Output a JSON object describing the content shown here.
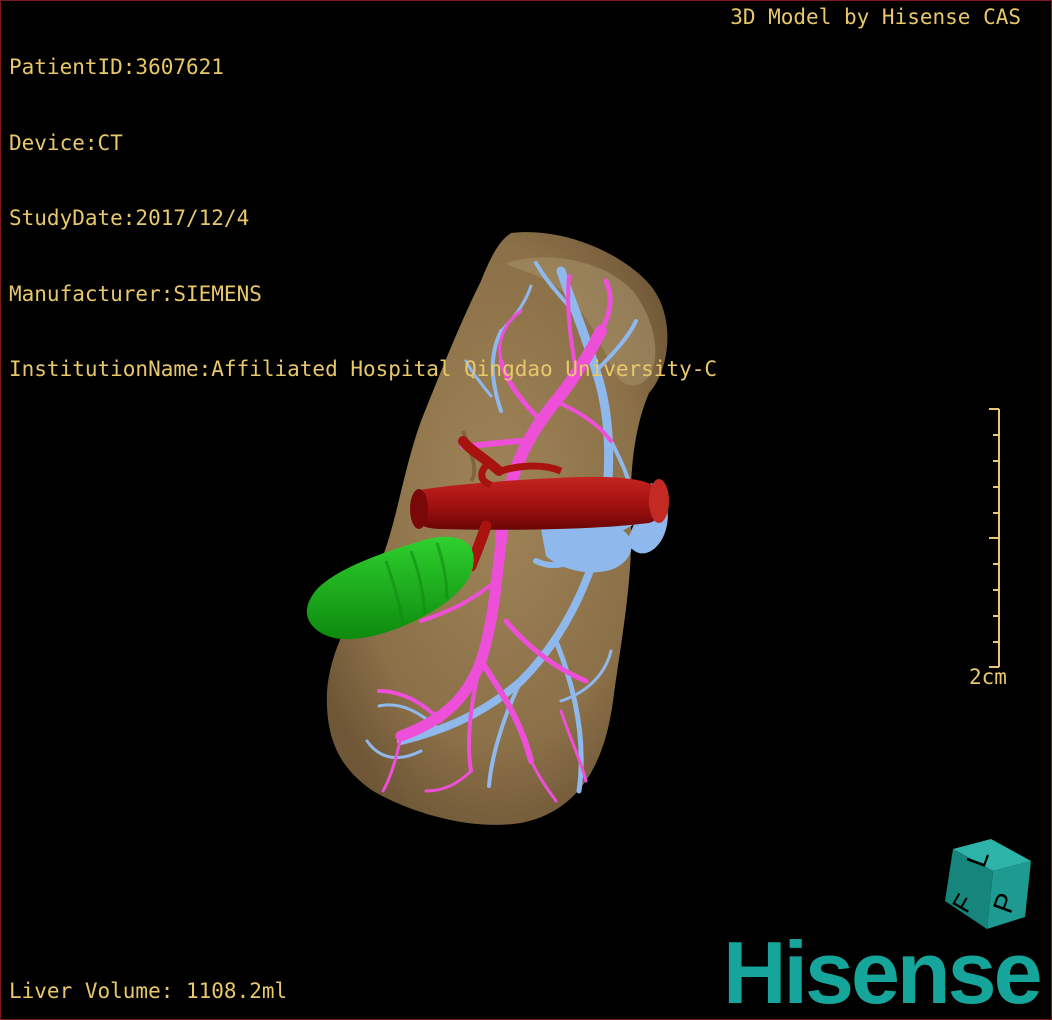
{
  "study": {
    "patient_id": "PatientID:3607621",
    "device": "Device:CT",
    "study_date": "StudyDate:2017/12/4",
    "manufacturer": "Manufacturer:SIEMENS",
    "institution": "InstitutionName:Affiliated Hospital Qingdao University-C"
  },
  "credit": "3D Model by Hisense CAS",
  "liver_volume": "Liver Volume: 1108.2ml",
  "scale_bar": {
    "label": "2cm"
  },
  "orientation_cube": {
    "faces": [
      "L",
      "P",
      "F"
    ]
  },
  "brand": "Hisense",
  "colors": {
    "overlay_text": "#e8c86a",
    "liver": "#8b7048",
    "portal_vein": "#ee4fd8",
    "hepatic_vein": "#8fb8ec",
    "artery_ivc": "#a8120f",
    "gallbladder": "#18b418",
    "brand": "#16a59a"
  }
}
